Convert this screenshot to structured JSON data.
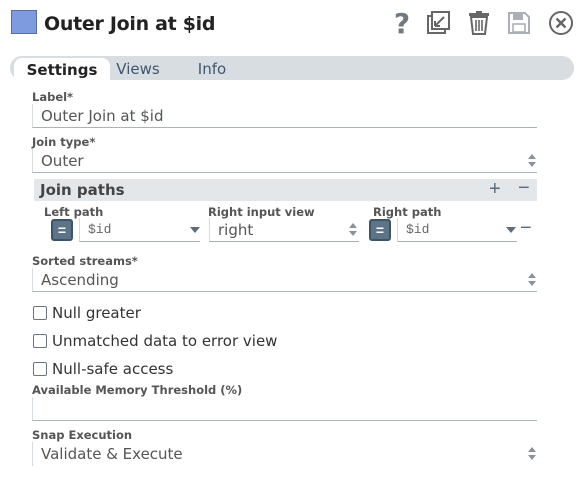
{
  "header": {
    "title": "Outer Join at $id",
    "icons": [
      "help-icon",
      "restore-icon",
      "delete-icon",
      "save-icon",
      "close-icon"
    ],
    "help_glyph": "?",
    "accent": "#7f9bdf"
  },
  "tabs": [
    {
      "label": "Settings",
      "active": true
    },
    {
      "label": "Views",
      "active": false
    },
    {
      "label": "Info",
      "active": false
    }
  ],
  "form": {
    "label": {
      "label": "Label*",
      "value": "Outer Join at $id"
    },
    "join_type": {
      "label": "Join type*",
      "value": "Outer"
    },
    "join_paths": {
      "title": "Join paths",
      "add_glyph": "+",
      "remove_glyph": "−",
      "left_path_label": "Left path",
      "right_input_view_label": "Right input view",
      "right_path_label": "Right path",
      "row": {
        "left_path": "$id",
        "right_input_view": "right",
        "right_path": "$id",
        "expr_glyph": "="
      }
    },
    "sorted_streams": {
      "label": "Sorted streams*",
      "value": "Ascending"
    },
    "null_greater": {
      "label": "Null greater",
      "checked": false
    },
    "unmatched": {
      "label": "Unmatched data to error view",
      "checked": false
    },
    "null_safe": {
      "label": "Null-safe access",
      "checked": false
    },
    "memory_threshold": {
      "label": "Available Memory Threshold (%)",
      "value": ""
    },
    "snap_execution": {
      "label": "Snap Execution",
      "value": "Validate & Execute"
    }
  }
}
